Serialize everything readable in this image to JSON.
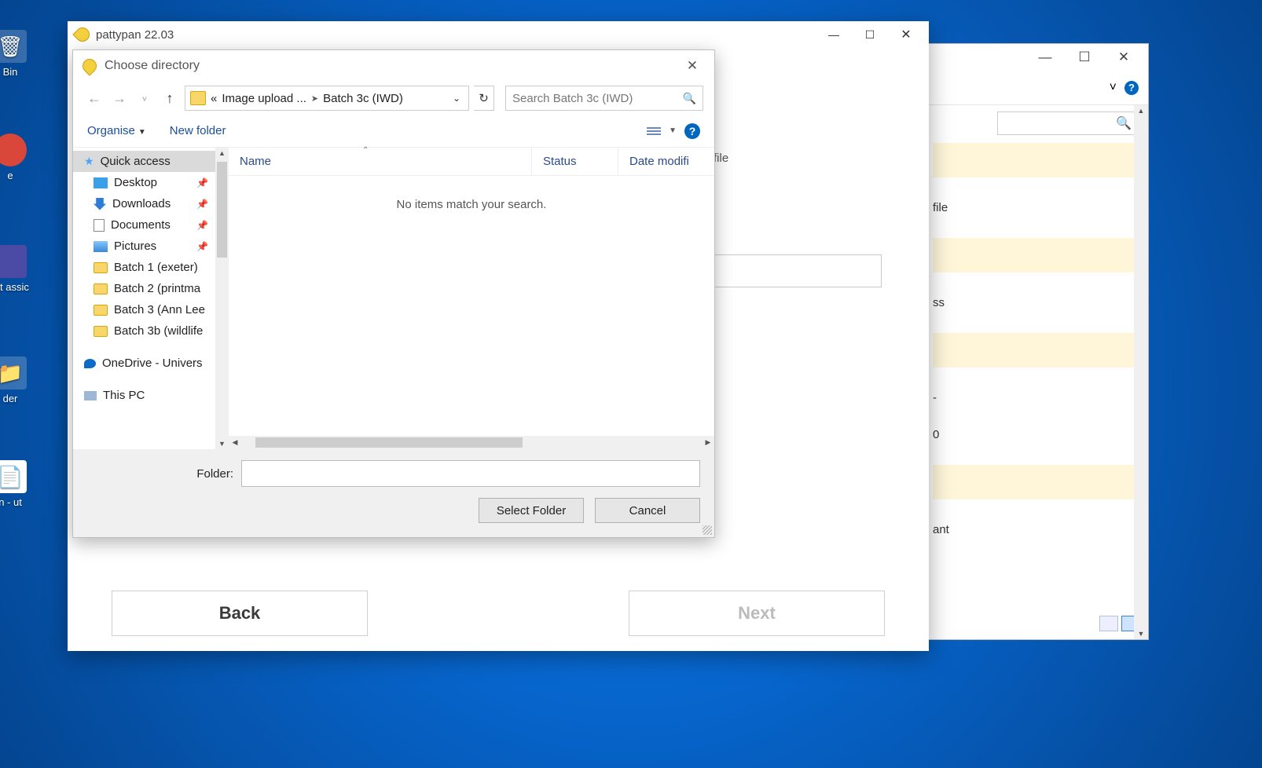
{
  "desktop": {
    "icons": [
      "Bin",
      "e",
      "oft assic",
      "der",
      "n - ut"
    ]
  },
  "background_window": {
    "controls": {
      "min": "—",
      "max": "☐",
      "close": "✕",
      "chev": "˅"
    },
    "peek_lines": [
      "file",
      "ss",
      "-",
      "0",
      "ant"
    ]
  },
  "app": {
    "title": "pattypan 22.03",
    "controls": {
      "minimize": "—",
      "maximize": "☐",
      "close": "✕"
    },
    "buttons": {
      "back": "Back",
      "next": "Next"
    },
    "peek_right": "file"
  },
  "dialog": {
    "title": "Choose directory",
    "breadcrumb": {
      "prefix": "«",
      "part1": "Image upload ...",
      "part2": "Batch 3c (IWD)"
    },
    "search_placeholder": "Search Batch 3c (IWD)",
    "toolbar": {
      "organise": "Organise",
      "new_folder": "New folder"
    },
    "columns": {
      "name": "Name",
      "status": "Status",
      "date": "Date modifi"
    },
    "empty": "No items match your search.",
    "tree": {
      "quick_access": "Quick access",
      "desktop": "Desktop",
      "downloads": "Downloads",
      "documents": "Documents",
      "pictures": "Pictures",
      "b1": "Batch 1 (exeter)",
      "b2": "Batch 2 (printma",
      "b3": "Batch 3 (Ann Lee",
      "b3b": "Batch 3b (wildlife",
      "onedrive": "OneDrive - Univers",
      "thispc": "This PC"
    },
    "footer": {
      "folder_label": "Folder:",
      "select": "Select Folder",
      "cancel": "Cancel"
    }
  }
}
